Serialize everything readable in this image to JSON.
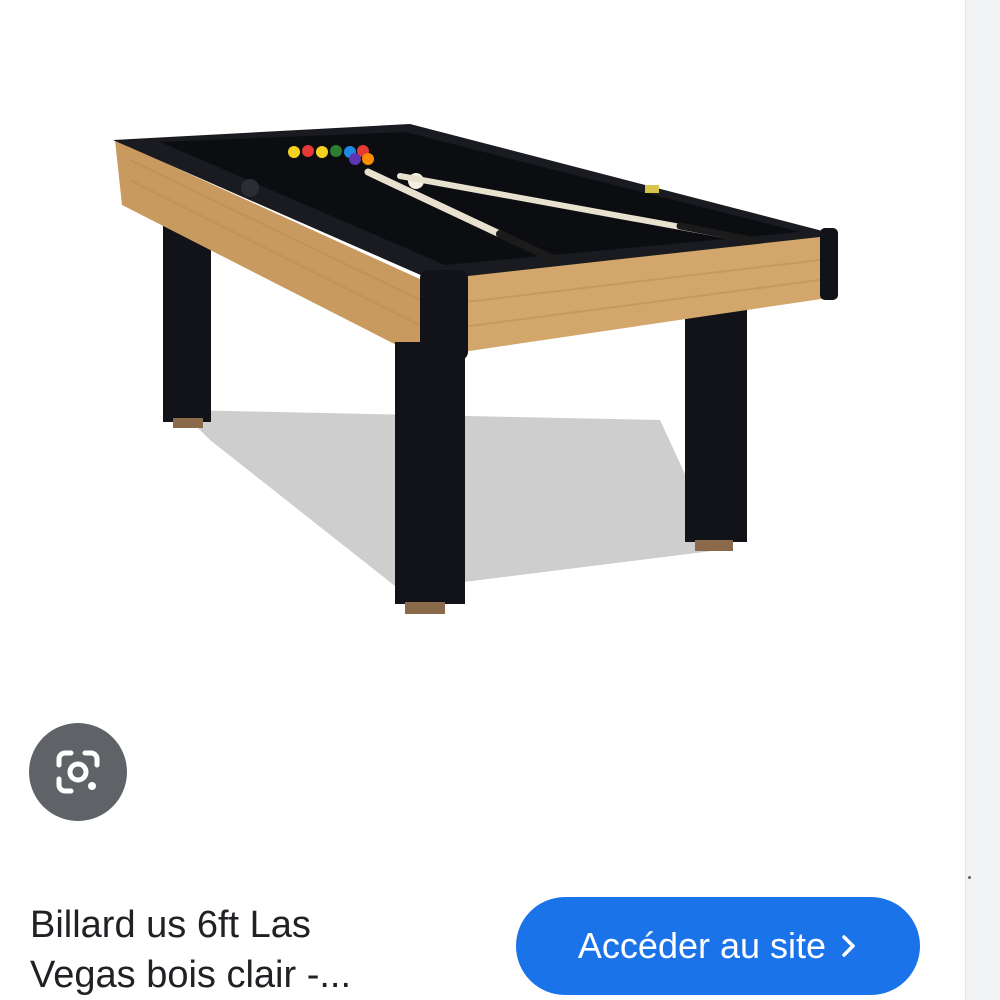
{
  "result": {
    "image_subject": "Billard us 6ft Las Vegas bois clair",
    "title": "Billard us 6ft Las\nVegas bois clair -...",
    "visit_label": "Accéder au site",
    "lens_icon": "google-lens-icon",
    "chevron_icon": "chevron-right-icon"
  },
  "colors": {
    "button_blue": "#1a73e8",
    "lens_gray": "#5f6368",
    "felt": "#0f1014",
    "wood": "#c99a5f"
  }
}
